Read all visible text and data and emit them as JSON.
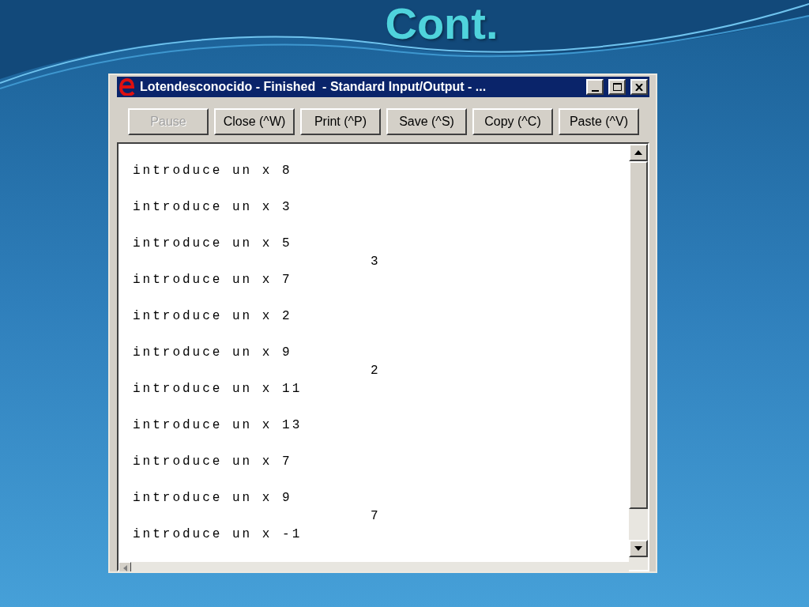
{
  "slide_title": "Cont.",
  "window": {
    "title": "Lotendesconocido - Finished  - Standard Input/Output - ..."
  },
  "buttons": [
    {
      "label": "Pause",
      "disabled": true
    },
    {
      "label": "Close (^W)",
      "disabled": false
    },
    {
      "label": "Print (^P)",
      "disabled": false
    },
    {
      "label": "Save (^S)",
      "disabled": false
    },
    {
      "label": "Copy (^C)",
      "disabled": false
    },
    {
      "label": "Paste (^V)",
      "disabled": false
    }
  ],
  "output": [
    {
      "prompt": "introduce un x 8"
    },
    {
      "prompt": "introduce un x 3"
    },
    {
      "prompt": "introduce un x 5",
      "result": "3"
    },
    {
      "prompt": "introduce un x 7"
    },
    {
      "prompt": "introduce un x 2"
    },
    {
      "prompt": "introduce un x 9",
      "result": "2"
    },
    {
      "prompt": "introduce un x 11"
    },
    {
      "prompt": "introduce un x 13"
    },
    {
      "prompt": "introduce un x 7"
    },
    {
      "prompt": "introduce un x 9",
      "result": "7"
    },
    {
      "prompt": "introduce un x -1"
    }
  ]
}
